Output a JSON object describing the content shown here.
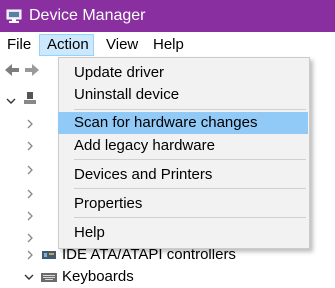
{
  "window": {
    "title": "Device Manager"
  },
  "menubar": {
    "items": [
      {
        "label": "File"
      },
      {
        "label": "Action"
      },
      {
        "label": "View"
      },
      {
        "label": "Help"
      }
    ]
  },
  "action_menu": {
    "items": [
      {
        "label": "Update driver"
      },
      {
        "label": "Uninstall device"
      },
      {
        "label": "Scan for hardware changes"
      },
      {
        "label": "Add legacy hardware"
      },
      {
        "label": "Devices and Printers"
      },
      {
        "label": "Properties"
      },
      {
        "label": "Help"
      }
    ],
    "highlighted": "Scan for hardware changes"
  },
  "tree": {
    "visible_items": [
      {
        "label": "IDE ATA/ATAPI controllers",
        "expanded": false
      },
      {
        "label": "Keyboards",
        "expanded": true
      }
    ]
  },
  "colors": {
    "titlebar": "#8a2fa0",
    "highlight": "#91c9f7",
    "menu_active": "#cce8ff"
  }
}
